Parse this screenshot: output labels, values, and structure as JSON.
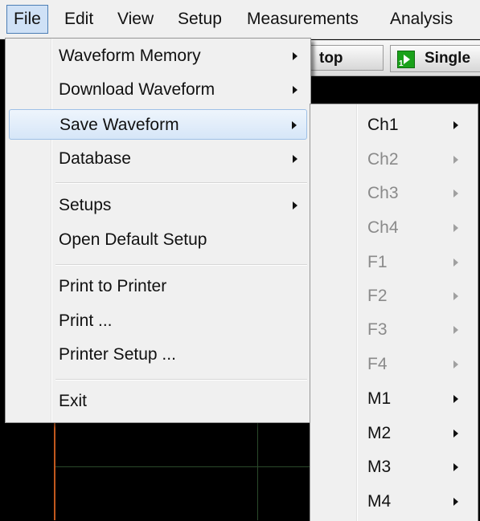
{
  "menubar": {
    "items": [
      "File",
      "Edit",
      "View",
      "Setup",
      "Measurements",
      "Analysis"
    ]
  },
  "toolbar": {
    "stop_label": "top",
    "single_label": "Single",
    "single_icon_number": "1"
  },
  "file_menu": {
    "items": [
      {
        "label": "Waveform Memory",
        "submenu": true
      },
      {
        "label": "Download Waveform",
        "submenu": true
      },
      {
        "label": "Save Waveform",
        "submenu": true,
        "highlighted": true
      },
      {
        "label": "Database",
        "submenu": true
      },
      {
        "label": "Setups",
        "submenu": true
      },
      {
        "label": "Open Default Setup",
        "submenu": false
      },
      {
        "label": "Print to Printer",
        "submenu": false
      },
      {
        "label": "Print ...",
        "submenu": false
      },
      {
        "label": "Printer Setup ...",
        "submenu": false
      },
      {
        "label": "Exit",
        "submenu": false
      }
    ]
  },
  "save_waveform_submenu": {
    "items": [
      {
        "label": "Ch1",
        "enabled": true
      },
      {
        "label": "Ch2",
        "enabled": false
      },
      {
        "label": "Ch3",
        "enabled": false
      },
      {
        "label": "Ch4",
        "enabled": false
      },
      {
        "label": "F1",
        "enabled": false
      },
      {
        "label": "F2",
        "enabled": false
      },
      {
        "label": "F3",
        "enabled": false
      },
      {
        "label": "F4",
        "enabled": false
      },
      {
        "label": "M1",
        "enabled": true
      },
      {
        "label": "M2",
        "enabled": true
      },
      {
        "label": "M3",
        "enabled": true
      },
      {
        "label": "M4",
        "enabled": true
      }
    ]
  },
  "colors": {
    "menu_bg": "#f0f0f0",
    "highlight": "#d6e6f8",
    "disabled_text": "#8a8a8a",
    "scope_bg": "#000000",
    "grid": "#2b4a2b",
    "marker": "#c2581e",
    "play_green": "#1aa11a"
  }
}
